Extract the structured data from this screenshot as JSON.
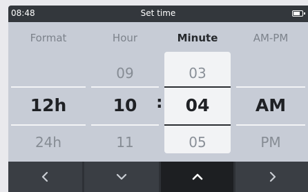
{
  "status_bar": {
    "time": "08:48",
    "title": "Set time",
    "battery_icon": "battery-icon"
  },
  "columns": {
    "format": {
      "header": "Format",
      "prev": "",
      "current": "12h",
      "next": "24h"
    },
    "hour": {
      "header": "Hour",
      "prev": "09",
      "current": "10",
      "next": "11"
    },
    "minute": {
      "header": "Minute",
      "prev": "03",
      "current": "04",
      "next": "05",
      "selected": true
    },
    "ampm": {
      "header": "AM-PM",
      "prev": "",
      "current": "AM",
      "next": "PM"
    }
  },
  "separator": ":",
  "nav": [
    {
      "icon": "chevron-left-icon",
      "active": false
    },
    {
      "icon": "chevron-down-icon",
      "active": false
    },
    {
      "icon": "chevron-up-icon",
      "active": true
    },
    {
      "icon": "chevron-right-icon",
      "active": false
    }
  ],
  "colors": {
    "background": "#c7ccd6",
    "status_bar": "#33373c",
    "selection": "#f2f3f5",
    "nav_bar": "#2e3136",
    "nav_active": "#1d1f22"
  }
}
